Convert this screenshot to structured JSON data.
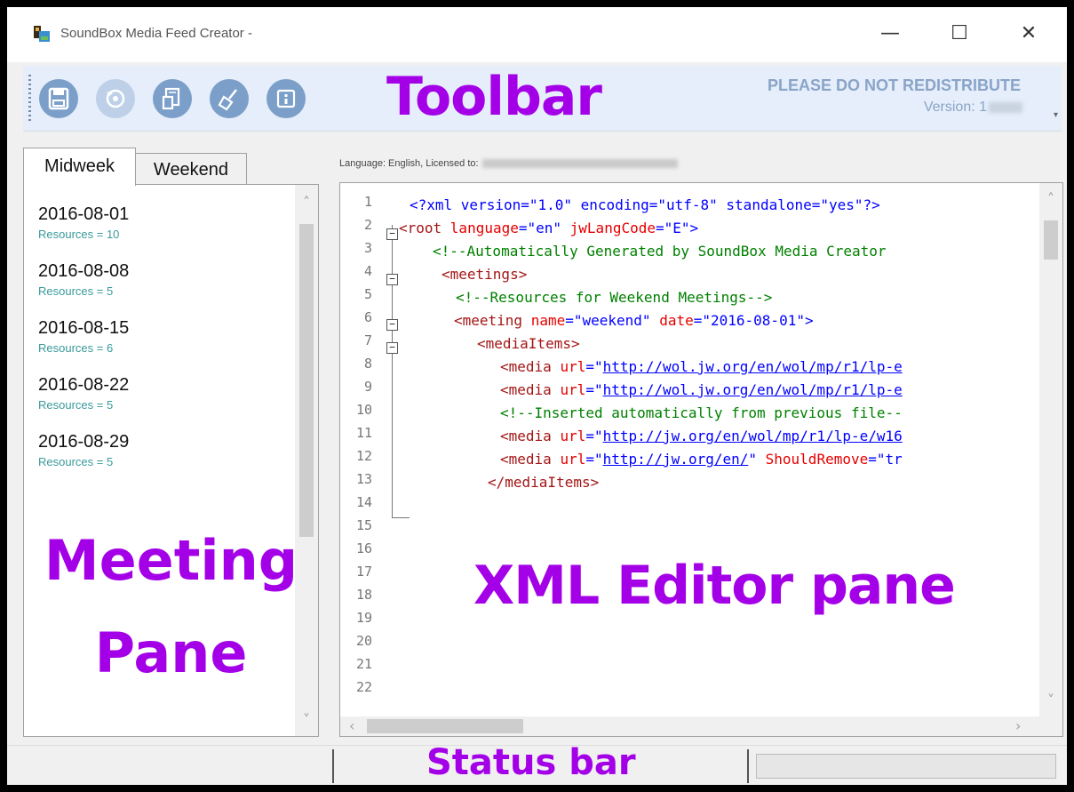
{
  "window": {
    "title": "SoundBox Media Feed Creator -",
    "minimize_glyph": "—",
    "maximize_glyph": "☐",
    "close_glyph": "✕"
  },
  "toolbar": {
    "label": "Toolbar",
    "notice": "PLEASE DO NOT REDISTRIBUTE",
    "version_label": "Version: 1",
    "buttons": [
      {
        "icon": "save-icon",
        "enabled": true
      },
      {
        "icon": "refresh-icon",
        "enabled": false
      },
      {
        "icon": "document-icon",
        "enabled": true
      },
      {
        "icon": "broom-icon",
        "enabled": true
      },
      {
        "icon": "info-icon",
        "enabled": true
      }
    ],
    "overflow_glyph": "▾"
  },
  "meeting_pane": {
    "label_line1": "Meeting",
    "label_line2": "Pane",
    "tabs": [
      {
        "label": "Midweek",
        "selected": true
      },
      {
        "label": "Weekend",
        "selected": false
      }
    ],
    "items": [
      {
        "date": "2016-08-01",
        "resources": "Resources = 10"
      },
      {
        "date": "2016-08-08",
        "resources": "Resources = 5"
      },
      {
        "date": "2016-08-15",
        "resources": "Resources = 6"
      },
      {
        "date": "2016-08-22",
        "resources": "Resources = 5"
      },
      {
        "date": "2016-08-29",
        "resources": "Resources = 5"
      }
    ],
    "scroll_up": "˄",
    "scroll_down": "˅"
  },
  "editor": {
    "license_text": "Language: English, Licensed to:",
    "label": "XML Editor pane",
    "line_numbers": [
      "1",
      "2",
      "3",
      "4",
      "5",
      "6",
      "7",
      "8",
      "9",
      "10",
      "11",
      "12",
      "13",
      "14",
      "15",
      "16",
      "17",
      "18",
      "19",
      "20",
      "21",
      "22"
    ],
    "lines": {
      "l1": "<?xml version=\"1.0\" encoding=\"utf-8\" standalone=\"yes\"?>",
      "l2a": "<root ",
      "l2b": "language",
      "l2c": "=\"en\" ",
      "l2d": "jwLangCode",
      "l2e": "=\"E\">",
      "l3": "<!--Automatically Generated by SoundBox Media Creator",
      "l4": "<meetings>",
      "l5": "<!--Resources for Weekend Meetings-->",
      "l6a": "<meeting ",
      "l6b": "name",
      "l6c": "=\"weekend\" ",
      "l6d": "date",
      "l6e": "=\"2016-08-01\">",
      "l7": "<mediaItems>",
      "l8a": "<media ",
      "l8b": "url",
      "l8c": "=\"",
      "l8d": "http://wol.jw.org/en/wol/mp/r1/lp-e",
      "l9d": "http://wol.jw.org/en/wol/mp/r1/lp-e",
      "l10": "<!--Inserted automatically from previous file--",
      "l11d": "http://jw.org/en/wol/mp/r1/lp-e/w16",
      "l12d": "http://jw.org/en/",
      "l12e": "\" ",
      "l12f": "ShouldRemove",
      "l12g": "=\"tr",
      "l13": "</mediaItems>"
    },
    "scroll_up": "˄",
    "scroll_down": "˅",
    "scroll_left": "‹",
    "scroll_right": "›"
  },
  "statusbar": {
    "label": "Status bar"
  }
}
